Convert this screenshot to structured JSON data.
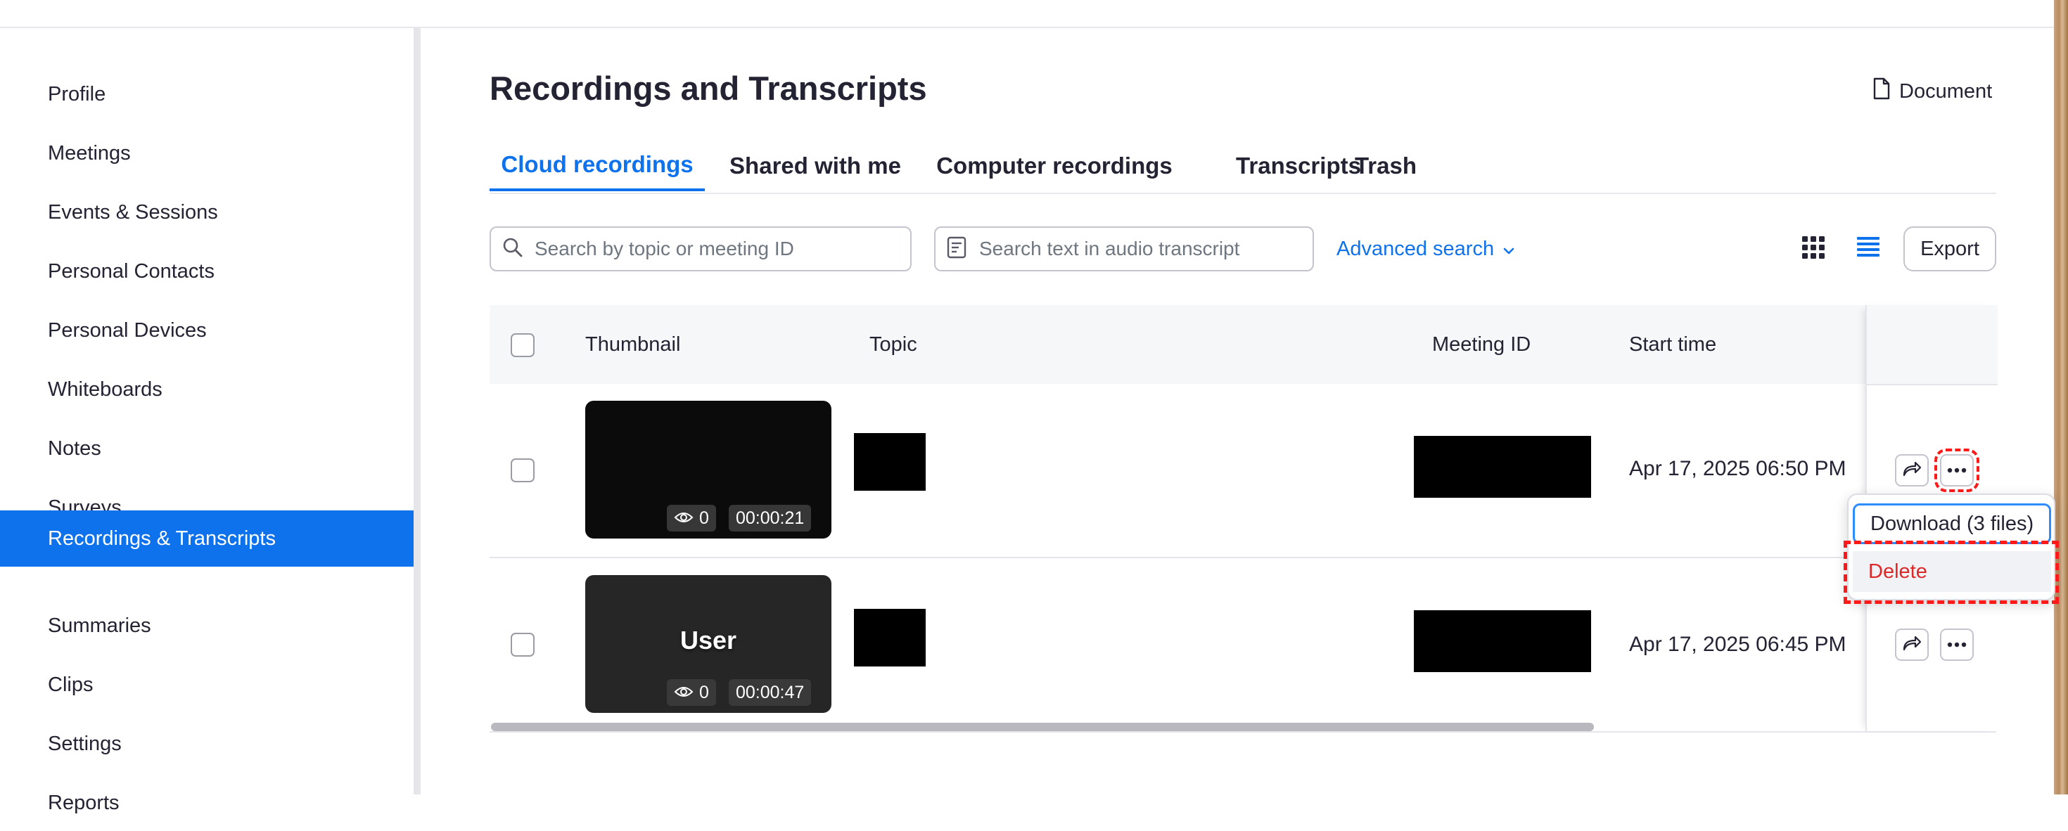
{
  "sidebar": {
    "items": [
      {
        "label": "Profile"
      },
      {
        "label": "Meetings"
      },
      {
        "label": "Events & Sessions"
      },
      {
        "label": "Personal Contacts"
      },
      {
        "label": "Personal Devices"
      },
      {
        "label": "Whiteboards"
      },
      {
        "label": "Notes"
      },
      {
        "label": "Surveys"
      },
      {
        "label": "Recordings & Transcripts",
        "active": true
      },
      {
        "label": "Summaries"
      },
      {
        "label": "Clips"
      },
      {
        "label": "Settings"
      },
      {
        "label": "Reports"
      }
    ]
  },
  "header": {
    "title": "Recordings and Transcripts",
    "document_link": "Document"
  },
  "tabs": [
    {
      "label": "Cloud recordings",
      "active": true
    },
    {
      "label": "Shared with me"
    },
    {
      "label": "Computer recordings"
    },
    {
      "label": "Transcripts"
    },
    {
      "label": "Trash"
    }
  ],
  "toolbar": {
    "search_placeholder": "Search by topic or meeting ID",
    "transcript_search_placeholder": "Search text in audio transcript",
    "advanced_search": "Advanced search",
    "export": "Export",
    "view_modes": [
      "grid-view-icon",
      "list-view-icon"
    ],
    "active_view": "list"
  },
  "table": {
    "columns": [
      "Thumbnail",
      "Topic",
      "Meeting ID",
      "Start time"
    ],
    "rows": [
      {
        "thumbnail_label": "",
        "views": "0",
        "duration": "00:00:21",
        "start_time": "Apr 17, 2025 06:50 PM"
      },
      {
        "thumbnail_label": "User",
        "views": "0",
        "duration": "00:00:47",
        "start_time": "Apr 17, 2025 06:45 PM"
      }
    ]
  },
  "menu": {
    "items": [
      {
        "label": "Download (3 files)"
      },
      {
        "label": "Delete"
      }
    ]
  },
  "colors": {
    "accent": "#0e72ed",
    "danger": "#de2828",
    "highlight": "#ff1a1a"
  }
}
